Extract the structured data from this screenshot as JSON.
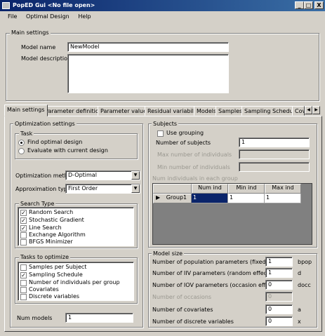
{
  "window": {
    "title": "PopED Gui <No file open>",
    "min": "_",
    "max": "□",
    "close": "X"
  },
  "menu": [
    "File",
    "Optimal Design",
    "Help"
  ],
  "main_settings": {
    "legend": "Main settings",
    "model_name_label": "Model name",
    "model_name_value": "NewModel",
    "model_description_label": "Model description",
    "model_description_value": ""
  },
  "tabs": [
    "Main settings",
    "Parameter definitions",
    "Parameter values",
    "Residual variability",
    "Models",
    "Samples",
    "Sampling Schedule",
    "Cov"
  ],
  "optimization": {
    "legend": "Optimization settings",
    "task_legend": "Task",
    "task_options": [
      "Find optimal design",
      "Evaluate with current design"
    ],
    "method_label": "Optimization method",
    "method_value": "D-Optimal",
    "approx_label": "Approximation type",
    "approx_value": "First Order",
    "search_legend": "Search Type",
    "search_items": [
      {
        "label": "Random Search",
        "checked": true
      },
      {
        "label": "Stochastic Gradient",
        "checked": true
      },
      {
        "label": "Line Search",
        "checked": true
      },
      {
        "label": "Exchange Algorithm",
        "checked": false
      },
      {
        "label": "BFGS Minimizer",
        "checked": false
      }
    ],
    "tasks_legend": "Tasks to optimize",
    "task_items": [
      {
        "label": "Samples per Subject",
        "checked": false
      },
      {
        "label": "Sampling Schedule",
        "checked": true
      },
      {
        "label": "Number of individuals per group",
        "checked": false
      },
      {
        "label": "Covariates",
        "checked": false
      },
      {
        "label": "Discrete variables",
        "checked": false
      }
    ],
    "num_models_label": "Num models",
    "num_models_value": "1"
  },
  "subjects": {
    "legend": "Subjects",
    "use_grouping": "Use grouping",
    "num_subjects_label": "Number of subjects",
    "num_subjects_value": "1",
    "max_ind_label": "Max number of individuals",
    "min_ind_label": "Min number of individuals",
    "grid_label": "Num individuals in each group",
    "grid_headers": [
      "Num ind",
      "Min ind",
      "Max ind"
    ],
    "grid_rows": [
      {
        "name": "Group1",
        "num": "1",
        "min": "1",
        "max": "1"
      }
    ]
  },
  "model_size": {
    "legend": "Model size",
    "rows": [
      {
        "label": "Number of population parameters (fixed effects)",
        "value": "1",
        "unit": "bpop",
        "disabled": false
      },
      {
        "label": "Number of IIV parameters (random effects)",
        "value": "1",
        "unit": "d",
        "disabled": false
      },
      {
        "label": "Number of IOV parameters (occasion effects)",
        "value": "0",
        "unit": "docc",
        "disabled": false
      },
      {
        "label": "Number of occasions",
        "value": "0",
        "unit": "",
        "disabled": true
      },
      {
        "label": "Number of covariates",
        "value": "0",
        "unit": "a",
        "disabled": false
      },
      {
        "label": "Number of discrete variables",
        "value": "0",
        "unit": "x",
        "disabled": false
      }
    ]
  }
}
